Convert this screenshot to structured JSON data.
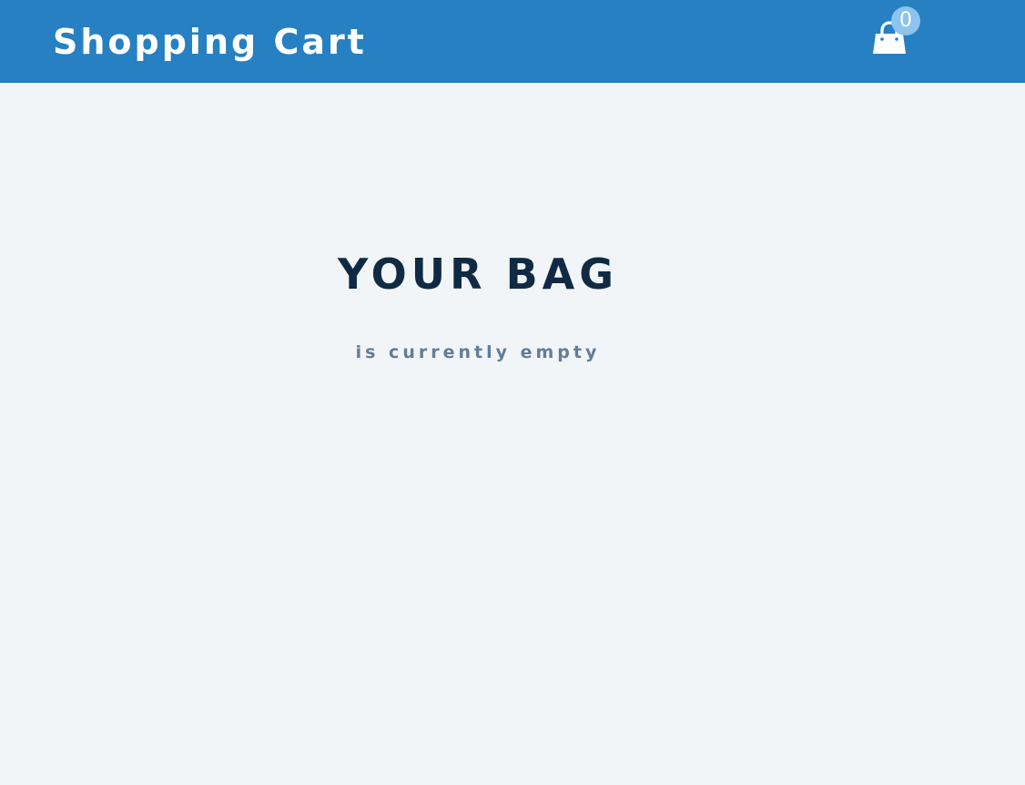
{
  "navbar": {
    "brand": "Shopping Cart",
    "cart_icon": "shopping-bag-icon",
    "cart_count": "0"
  },
  "cart": {
    "title": "YOUR BAG",
    "empty_message": "is currently empty"
  },
  "colors": {
    "navbar_bg": "#2680c2",
    "page_bg": "#f1f5f8",
    "badge_bg": "#8ac4ef",
    "title_text": "#102a43",
    "subtitle_text": "#617d98"
  }
}
